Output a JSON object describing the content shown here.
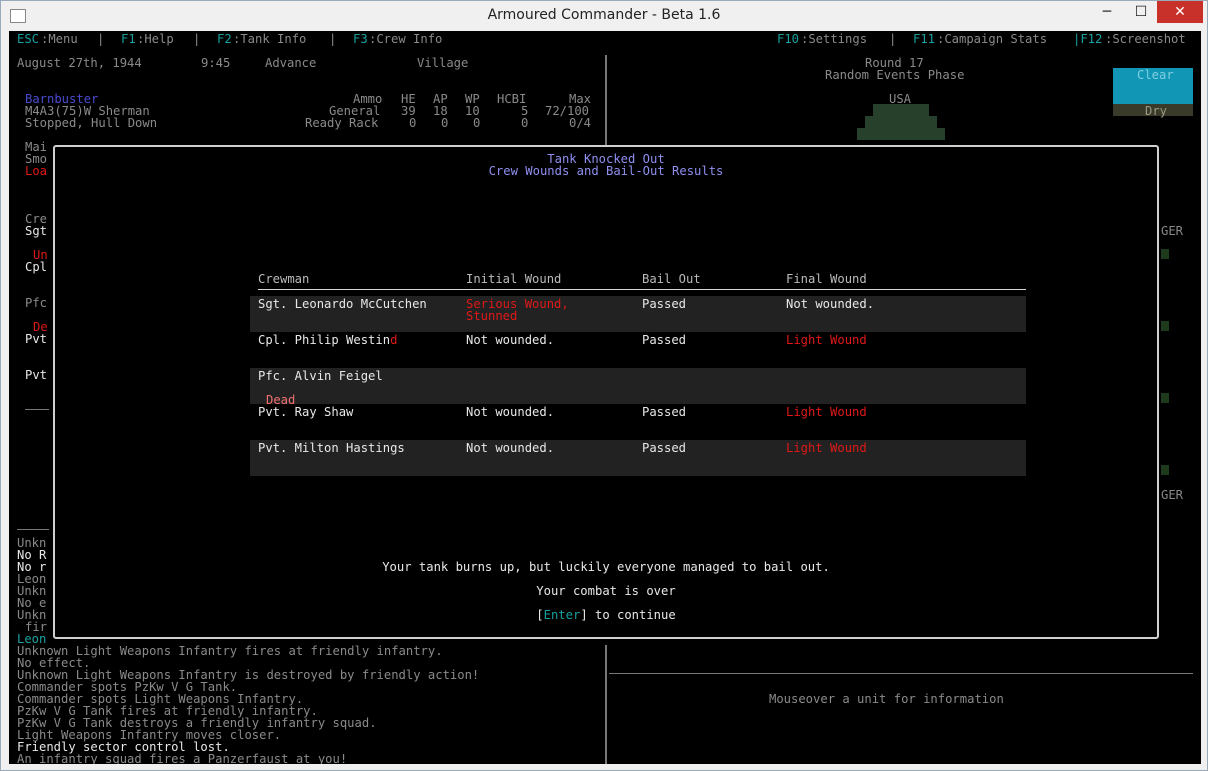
{
  "window": {
    "title": "Armoured Commander - Beta 1.6",
    "minimize": "─",
    "maximize": "☐",
    "close": "✕"
  },
  "menu": {
    "esc_key": "ESC",
    "esc_label": ":Menu",
    "sep1": "|",
    "f1_key": "F1",
    "f1_label": ":Help",
    "sep2": "|",
    "f2_key": "F2",
    "f2_label": ":Tank Info",
    "sep3": "|",
    "f3_key": "F3",
    "f3_label": ":Crew Info",
    "f10_key": "F10",
    "f10_label": ":Settings",
    "sep4": "|",
    "f11_key": "F11",
    "f11_label": ":Campaign Stats",
    "f12_key": "|F12",
    "f12_label": ":Screenshot"
  },
  "status": {
    "date": "August 27th, 1944",
    "time": "9:45",
    "action": "Advance",
    "area": "Village"
  },
  "tank": {
    "name": "Barnbuster",
    "model": "M4A3(75)W Sherman",
    "state": "Stopped, Hull Down",
    "ammo_headers": {
      "ammo": "Ammo",
      "he": "HE",
      "ap": "AP",
      "wp": "WP",
      "hcbi": "HCBI",
      "max": "Max"
    },
    "general": {
      "label": "General",
      "he": "39",
      "ap": "18",
      "wp": "10",
      "hcbi": "5",
      "max": "72/100"
    },
    "ready": {
      "label": "Ready Rack",
      "he": "0",
      "ap": "0",
      "wp": "0",
      "hcbi": "0",
      "max": "0/4"
    }
  },
  "left_fragments": [
    "Mai",
    "Smo",
    "Loa",
    "Cre",
    "Sgt",
    "Un",
    "Cpl",
    "Pfc",
    "De",
    "Pvt",
    "Pvt"
  ],
  "round": {
    "label": "Round 17",
    "phase": "Random Events Phase"
  },
  "map": {
    "nation": "USA",
    "ger1": "GER",
    "ger2": "GER"
  },
  "weather": {
    "sky": "Clear",
    "ground": "Dry"
  },
  "log_fragments": [
    "Unkn",
    "No R",
    "No r",
    "Leon",
    "Unkn",
    "No e",
    "Unkn",
    "fir",
    "Leon"
  ],
  "log": [
    "Unknown Light Weapons Infantry fires at friendly infantry.",
    "No effect.",
    "Unknown Light Weapons Infantry is destroyed by friendly action!",
    "Commander spots PzKw V G Tank.",
    "Commander spots Light Weapons Infantry.",
    "PzKw V G Tank fires at friendly infantry.",
    "PzKw V G Tank destroys a friendly infantry squad.",
    "Light Weapons Infantry moves closer.",
    "Friendly sector control lost.",
    "An infantry squad fires a Panzerfaust at you!"
  ],
  "info_panel": {
    "hint": "Mouseover a unit for information"
  },
  "dialog": {
    "title": "Tank Knocked Out",
    "subtitle": "Crew Wounds and Bail-Out Results",
    "headers": {
      "crewman": "Crewman",
      "initial": "Initial Wound",
      "bail": "Bail Out",
      "final": "Final Wound"
    },
    "crew": [
      {
        "name": "Sgt. Leonardo McCutchen",
        "initial": "Serious Wound,",
        "initial2": "Stunned",
        "bail": "Passed",
        "final": "Not wounded."
      },
      {
        "name": "Cpl. Philip Westin",
        "name_tail": "d",
        "initial": "Not wounded.",
        "bail": "Passed",
        "final": "Light Wound"
      },
      {
        "name": "Pfc. Alvin Feigel",
        "status": "Dead"
      },
      {
        "name": "Pvt. Ray Shaw",
        "initial": "Not wounded.",
        "bail": "Passed",
        "final": "Light Wound"
      },
      {
        "name": "Pvt. Milton Hastings",
        "initial": "Not wounded.",
        "bail": "Passed",
        "final": "Light Wound"
      }
    ],
    "message": "Your tank burns up, but luckily everyone managed to bail out.",
    "combat_over": "Your combat is over",
    "enter_open": "[",
    "enter_key": "Enter",
    "enter_close": "] to continue"
  }
}
